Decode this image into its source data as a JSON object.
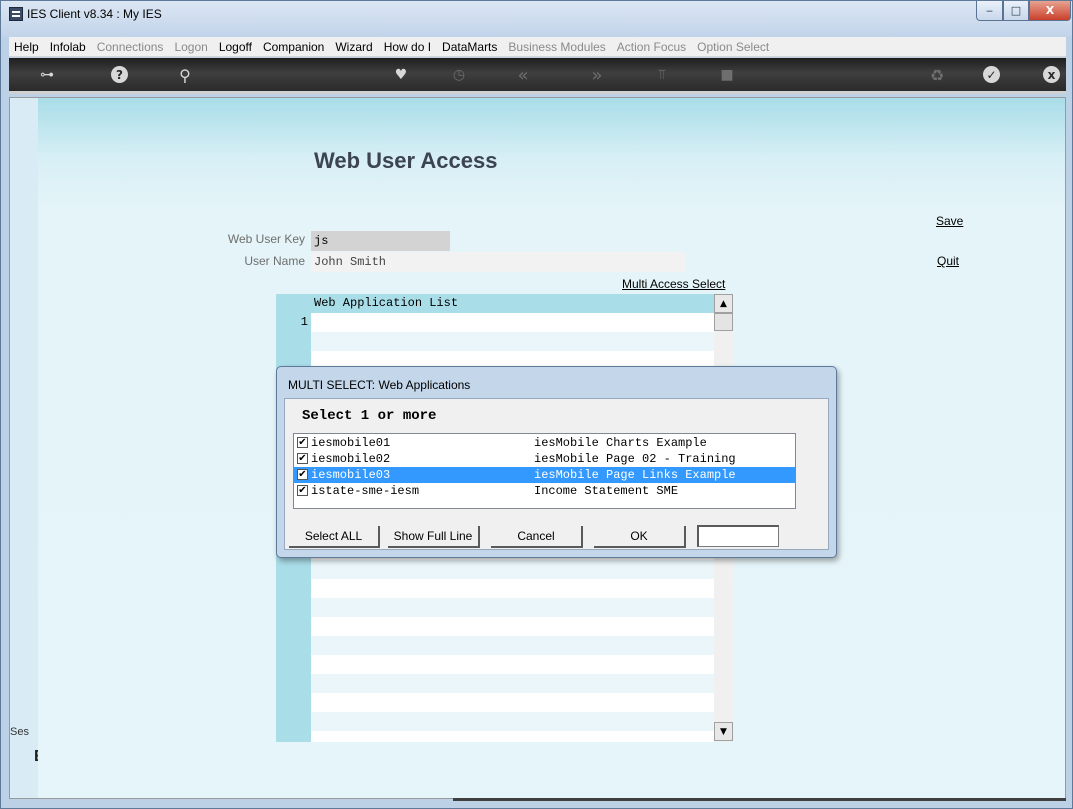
{
  "window": {
    "title": "IES Client v8.34 : My IES",
    "minimize_glyph": "‒",
    "maximize_glyph": "□",
    "close_glyph": "X"
  },
  "menu": [
    {
      "label": "Help",
      "enabled": true
    },
    {
      "label": "Infolab",
      "enabled": true
    },
    {
      "label": "Connections",
      "enabled": false
    },
    {
      "label": "Logon",
      "enabled": false
    },
    {
      "label": "Logoff",
      "enabled": true
    },
    {
      "label": "Companion",
      "enabled": true
    },
    {
      "label": "Wizard",
      "enabled": true
    },
    {
      "label": "How do I",
      "enabled": true
    },
    {
      "label": "DataMarts",
      "enabled": true
    },
    {
      "label": "Business Modules",
      "enabled": false
    },
    {
      "label": "Action Focus",
      "enabled": false
    },
    {
      "label": "Option Select",
      "enabled": false
    }
  ],
  "toolbar": {
    "icons": [
      "key-icon",
      "help-icon",
      "search-icon",
      "heart-icon",
      "clock-icon",
      "rewind-icon",
      "fast-forward-icon",
      "tree-icon",
      "stop-icon",
      "recycle-icon",
      "check-icon",
      "close-icon"
    ],
    "key": "⊶",
    "help": "?",
    "search": "⚲",
    "heart": "♥",
    "clock": "◷",
    "rewind": "«",
    "forward": "»",
    "tree": "⫪",
    "stop": "■",
    "recycle": "♻",
    "check": "✓",
    "close": "x"
  },
  "page": {
    "title": "Web User Access",
    "save_link": "Save",
    "quit_link": "Quit",
    "multi_access_link": "Multi Access Select",
    "side_tab_label": "Ses",
    "side_glyph": "E"
  },
  "form": {
    "web_user_key_label": "Web User Key",
    "web_user_key_value": "js",
    "user_name_label": "User Name",
    "user_name_value": "John Smith"
  },
  "grid": {
    "header": "Web Application List",
    "row_numbers": [
      "1"
    ],
    "scroll_up": "▲",
    "scroll_down": "▼"
  },
  "dialog": {
    "title": "MULTI SELECT: Web Applications",
    "prompt": "Select 1 or more",
    "options": [
      {
        "code": "iesmobile01",
        "description": "iesMobile Charts Example",
        "checked": true,
        "selected": false
      },
      {
        "code": "iesmobile02",
        "description": "iesMobile Page 02 - Training",
        "checked": true,
        "selected": false
      },
      {
        "code": "iesmobile03",
        "description": "iesMobile Page Links Example",
        "checked": true,
        "selected": true
      },
      {
        "code": "istate-sme-iesm",
        "description": "Income Statement SME",
        "checked": true,
        "selected": false
      }
    ],
    "check_glyph": "✔",
    "buttons": {
      "select_all": "Select ALL",
      "show_full_line": "Show Full Line",
      "cancel": "Cancel",
      "ok": "OK"
    },
    "filter_value": ""
  }
}
